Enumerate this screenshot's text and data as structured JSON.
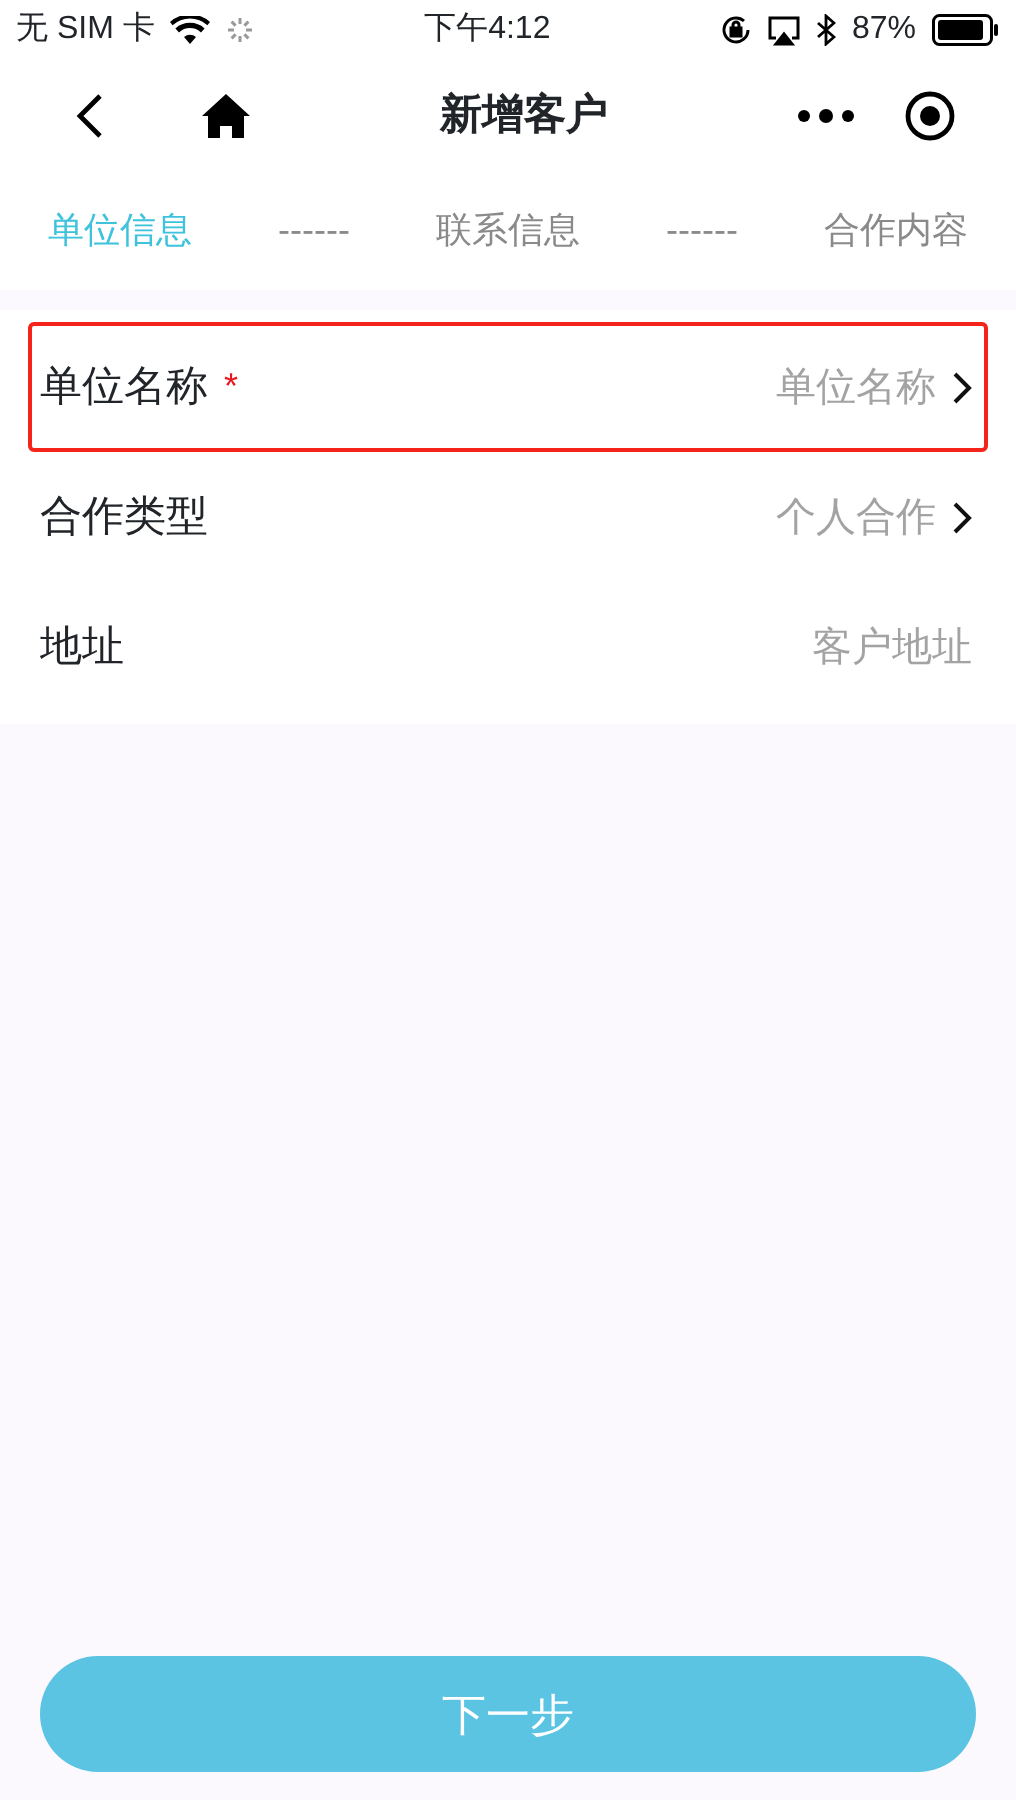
{
  "status_bar": {
    "carrier": "无 SIM 卡",
    "time": "下午4:12",
    "battery": "87%"
  },
  "nav": {
    "title": "新增客户"
  },
  "steps": [
    {
      "kind": "step",
      "label": "单位信息",
      "selected": true
    },
    {
      "kind": "separator",
      "label": "------"
    },
    {
      "kind": "step",
      "label": "联系信息",
      "selected": false
    },
    {
      "kind": "separator",
      "label": "------"
    },
    {
      "kind": "step",
      "label": "合作内容",
      "selected": false
    }
  ],
  "fields": [
    {
      "kind": "select",
      "label": "单位名称",
      "required_mark": "*",
      "highlighted": true,
      "placeholder": "单位名称"
    },
    {
      "kind": "select",
      "label": "合作类型",
      "highlighted": false,
      "placeholder": "个人合作"
    },
    {
      "kind": "input",
      "label": "地址",
      "highlighted": false,
      "placeholder": "客户地址"
    }
  ],
  "next_button": "下一步"
}
